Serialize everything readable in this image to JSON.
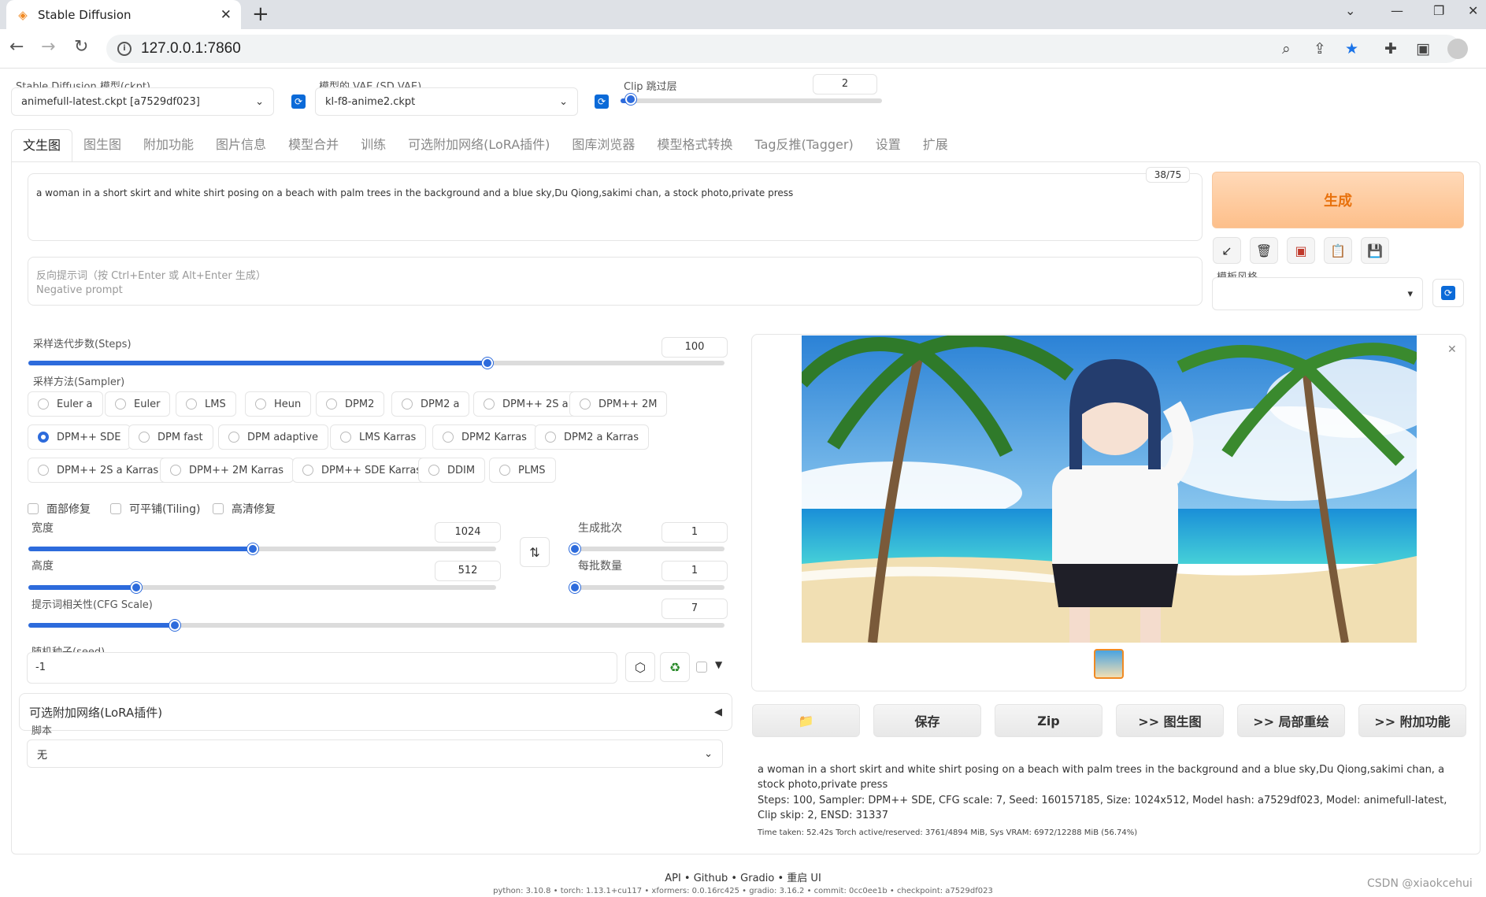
{
  "browser": {
    "tab_title": "Stable Diffusion",
    "url": "127.0.0.1:7860"
  },
  "top": {
    "model_label": "Stable Diffusion 模型(ckpt)",
    "model_value": "animefull-latest.ckpt [a7529df023]",
    "vae_label": "模型的 VAE (SD VAE)",
    "vae_value": "kl-f8-anime2.ckpt",
    "clip_label": "Clip 跳过层",
    "clip_value": "2",
    "clip_fraction": 0.04
  },
  "tabs": [
    "文生图",
    "图生图",
    "附加功能",
    "图片信息",
    "模型合并",
    "训练",
    "可选附加网络(LoRA插件)",
    "图库浏览器",
    "模型格式转换",
    "Tag反推(Tagger)",
    "设置",
    "扩展"
  ],
  "prompt": {
    "text": "a woman in a short skirt and white shirt posing on a beach with palm trees in the background and a blue sky,Du Qiong,sakimi chan, a stock photo,private press",
    "token_count": "38/75",
    "negative_placeholder_1": "反向提示词（按 Ctrl+Enter 或 Alt+Enter 生成）",
    "negative_placeholder_2": "Negative prompt"
  },
  "generate_label": "生成",
  "style_label": "模板风格",
  "steps": {
    "label": "采样迭代步数(Steps)",
    "value": "100",
    "fraction": 0.66
  },
  "sampler": {
    "label": "采样方法(Sampler)",
    "options": [
      "Euler a",
      "Euler",
      "LMS",
      "Heun",
      "DPM2",
      "DPM2 a",
      "DPM++ 2S a",
      "DPM++ 2M",
      "DPM++ SDE",
      "DPM fast",
      "DPM adaptive",
      "LMS Karras",
      "DPM2 Karras",
      "DPM2 a Karras",
      "DPM++ 2S a Karras",
      "DPM++ 2M Karras",
      "DPM++ SDE Karras",
      "DDIM",
      "PLMS"
    ],
    "selected": "DPM++ SDE"
  },
  "checks": {
    "face": "面部修复",
    "tiling": "可平铺(Tiling)",
    "hires": "高清修复"
  },
  "width": {
    "label": "宽度",
    "value": "1024",
    "fraction": 0.48
  },
  "height": {
    "label": "高度",
    "value": "512",
    "fraction": 0.23
  },
  "batch_count": {
    "label": "生成批次",
    "value": "1",
    "fraction": 0.0
  },
  "batch_size": {
    "label": "每批数量",
    "value": "1",
    "fraction": 0.0
  },
  "cfg": {
    "label": "提示词相关性(CFG Scale)",
    "value": "7",
    "fraction": 0.21
  },
  "seed": {
    "label": "随机种子(seed)",
    "value": "-1"
  },
  "lora_label": "可选附加网络(LoRA插件)",
  "script": {
    "label": "脚本",
    "value": "无"
  },
  "output_buttons": [
    "保存",
    "Zip",
    ">> 图生图",
    ">> 局部重绘",
    ">> 附加功能"
  ],
  "info": {
    "prompt": "a woman in a short skirt and white shirt posing on a beach with palm trees in the background and a blue sky,Du Qiong,sakimi chan, a stock photo,private press",
    "params": "Steps: 100, Sampler: DPM++ SDE, CFG scale: 7, Seed: 160157185, Size: 1024x512, Model hash: a7529df023, Model: animefull-latest, Clip skip: 2, ENSD: 31337",
    "time": "Time taken: 52.42s  Torch active/reserved: 3761/4894 MiB, Sys VRAM: 6972/12288 MiB (56.74%)"
  },
  "footer": {
    "links": "API  •  Github  •  Gradio  •  重启 UI",
    "versions": "python: 3.10.8  •  torch: 1.13.1+cu117  •  xformers: 0.0.16rc425  •  gradio: 3.16.2  •  commit: 0cc0ee1b  •  checkpoint: a7529df023",
    "watermark": "CSDN @xiaokcehui"
  }
}
